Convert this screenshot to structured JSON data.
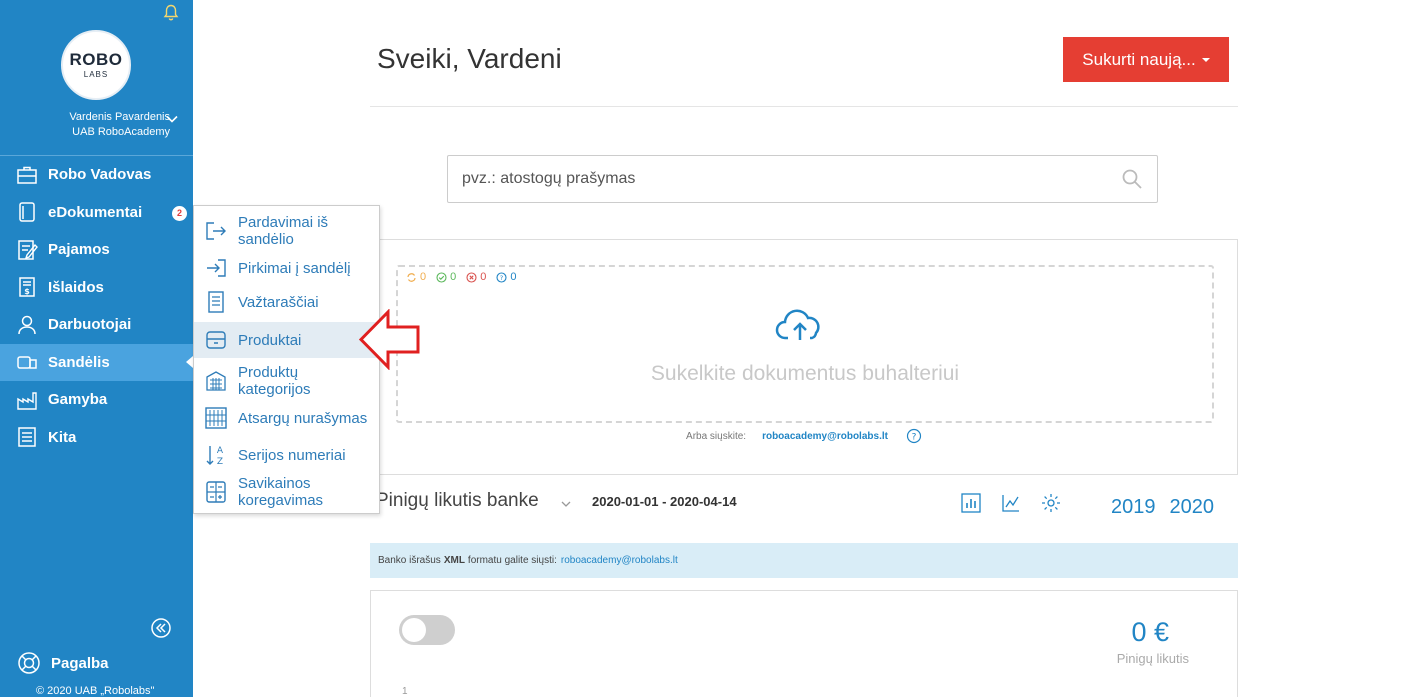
{
  "sidebar": {
    "logo_top": "ROBO",
    "logo_bottom": "LABS",
    "user_name": "Vardenis Pavardenis",
    "company": "UAB RoboAcademy",
    "items": [
      {
        "label": "Robo Vadovas",
        "icon": "briefcase-icon"
      },
      {
        "label": "eDokumentai",
        "icon": "documents-icon",
        "badge": "2"
      },
      {
        "label": "Pajamos",
        "icon": "income-icon"
      },
      {
        "label": "Išlaidos",
        "icon": "expenses-icon"
      },
      {
        "label": "Darbuotojai",
        "icon": "employee-icon"
      },
      {
        "label": "Sandėlis",
        "icon": "warehouse-icon",
        "active": true
      },
      {
        "label": "Gamyba",
        "icon": "factory-icon"
      },
      {
        "label": "Kita",
        "icon": "other-icon"
      }
    ],
    "help_label": "Pagalba",
    "copyright": "© 2020 UAB „Robolabs\""
  },
  "submenu": {
    "items": [
      {
        "label_line1": "Pardavimai iš",
        "label_line2": "sandėlio",
        "icon": "export-icon"
      },
      {
        "label_line1": "Pirkimai į sandėlį",
        "label_line2": "",
        "icon": "import-icon"
      },
      {
        "label_line1": "Važtaraščiai",
        "label_line2": "",
        "icon": "waybill-icon"
      },
      {
        "label_line1": "Produktai",
        "label_line2": "",
        "icon": "box-icon",
        "active": true
      },
      {
        "label_line1": "Produktų",
        "label_line2": "kategorijos",
        "icon": "category-icon"
      },
      {
        "label_line1": "Atsargų nurašymas",
        "label_line2": "",
        "icon": "writeoff-icon"
      },
      {
        "label_line1": "Serijos numeriai",
        "label_line2": "",
        "icon": "sort-az-icon"
      },
      {
        "label_line1": "Savikainos",
        "label_line2": "koregavimas",
        "icon": "calculator-icon"
      }
    ]
  },
  "header": {
    "greeting": "Sveiki, Vardeni",
    "create_label": "Sukurti naują..."
  },
  "search": {
    "placeholder": "pvz.: atostogų prašymas"
  },
  "upload": {
    "stats": [
      {
        "value": "0",
        "color": "#f0ad4e",
        "icon": "sync-icon"
      },
      {
        "value": "0",
        "color": "#5cb85c",
        "icon": "check-circle-icon"
      },
      {
        "value": "0",
        "color": "#d9534f",
        "icon": "x-circle-icon"
      },
      {
        "value": "0",
        "color": "#2185c5",
        "icon": "question-circle-icon"
      }
    ],
    "text": "Sukelkite dokumentus buhalteriui",
    "send_label": "Arba siųskite:",
    "email": "roboacademy@robolabs.lt"
  },
  "bank": {
    "title": "Pinigų likutis banke",
    "date_range": "2020-01-01 - 2020-04-14",
    "years": [
      "2019",
      "2020"
    ],
    "info_prefix": "Banko išrašus",
    "info_bold": "XML",
    "info_suffix": "formatu galite siųsti:",
    "info_email": "roboacademy@robolabs.lt",
    "amount": "0 €",
    "amount_label": "Pinigų likutis",
    "axis_value": "1"
  }
}
